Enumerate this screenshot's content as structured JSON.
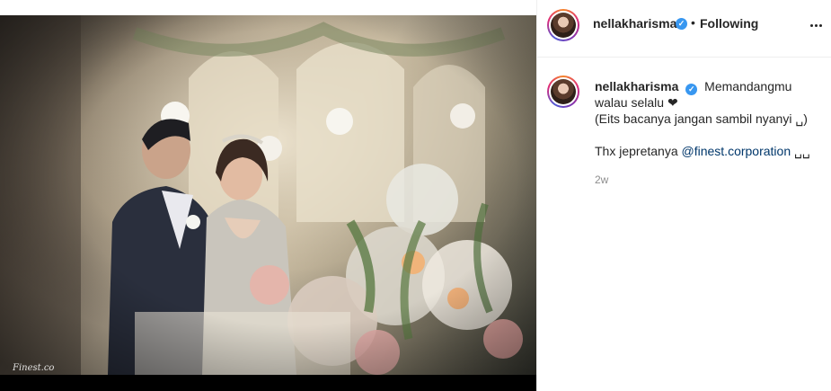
{
  "post": {
    "image_watermark": "Finest.co"
  },
  "header": {
    "username": "nellakharisma",
    "verified_icon": "verified-badge-icon",
    "separator": "•",
    "follow_state": "Following",
    "more_icon": "more-options-icon"
  },
  "caption": {
    "username": "nellakharisma",
    "line1": "Memandangmu",
    "line2": "walau selalu ❤",
    "line3": "(Eits bacanya jangan sambil nyanyi ␣)",
    "line4_prefix": "Thx jepretanya ",
    "mention": "@finest.corporation",
    "line4_suffix": " ␣␣",
    "timestamp": "2w"
  },
  "colors": {
    "verified": "#3897f0",
    "mention": "#00376b",
    "meta_text": "#8e8e8e"
  }
}
